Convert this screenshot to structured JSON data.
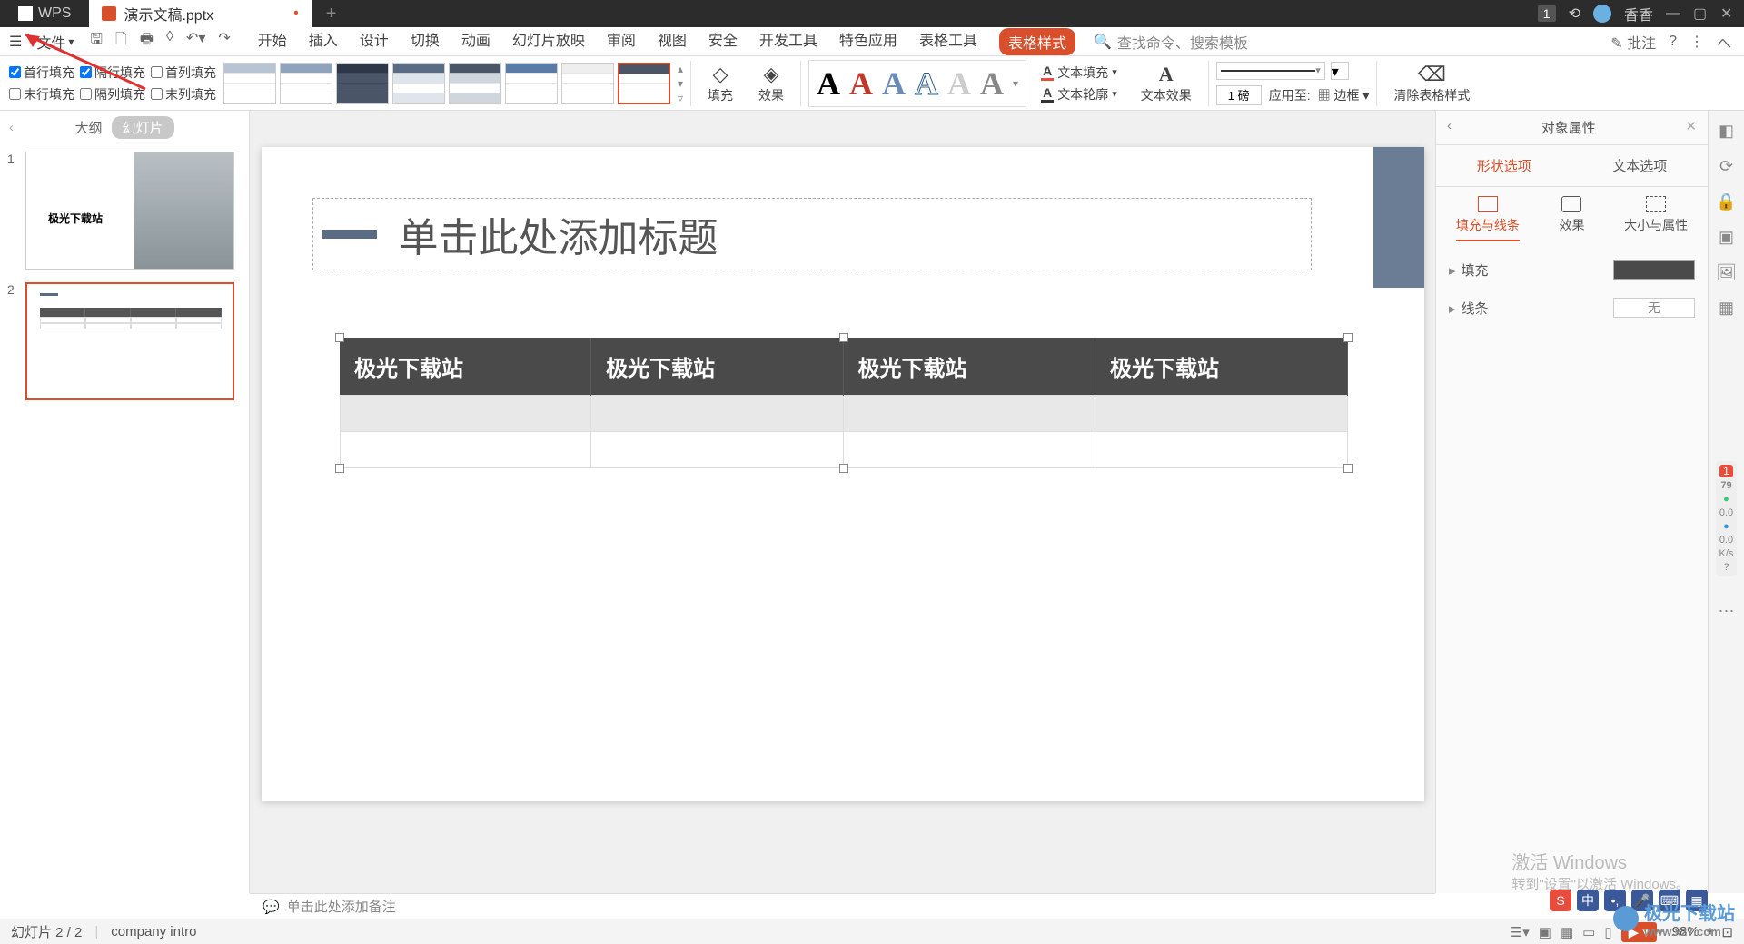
{
  "titlebar": {
    "wps": "WPS",
    "doc_name": "演示文稿.pptx",
    "badge": "1",
    "username": "香香"
  },
  "menubar": {
    "file": "文件",
    "items": [
      "开始",
      "插入",
      "设计",
      "切换",
      "动画",
      "幻灯片放映",
      "审阅",
      "视图",
      "安全",
      "开发工具",
      "特色应用",
      "表格工具",
      "表格样式"
    ],
    "active_index": 12,
    "search_placeholder": "查找命令、搜索模板",
    "annotate": "批注"
  },
  "ribbon": {
    "fills": {
      "r1": [
        "首行填充",
        "隔行填充",
        "首列填充"
      ],
      "r2": [
        "末行填充",
        "隔列填充",
        "末列填充"
      ],
      "checked": [
        true,
        true,
        false,
        false,
        false,
        false
      ]
    },
    "fill_label": "填充",
    "effect_label": "效果",
    "text_fill": "文本填充",
    "text_outline": "文本轮廓",
    "text_effect": "文本效果",
    "pen_weight": "1 磅",
    "apply_to": "应用至:",
    "border": "边框",
    "clear_style": "清除表格样式"
  },
  "panel": {
    "outline": "大纲",
    "slides": "幻灯片",
    "thumb1_text": "极光下载站"
  },
  "slide": {
    "title_placeholder": "单击此处添加标题",
    "table_headers": [
      "极光下载站",
      "极光下载站",
      "极光下载站",
      "极光下载站"
    ]
  },
  "props": {
    "title": "对象属性",
    "tab_shape": "形状选项",
    "tab_text": "文本选项",
    "sub_fill": "填充与线条",
    "sub_effect": "效果",
    "sub_size": "大小与属性",
    "fill": "填充",
    "line": "线条",
    "none": "无"
  },
  "notes": {
    "placeholder": "单击此处添加备注"
  },
  "status": {
    "slide_info": "幻灯片 2 / 2",
    "template": "company intro",
    "zoom": "98%"
  },
  "activate": {
    "title": "激活 Windows",
    "sub": "转到\"设置\"以激活 Windows。"
  },
  "watermark": {
    "site": "极光下载站",
    "url": "www.xz7.com"
  },
  "perf": {
    "count": "1",
    "val": "79",
    "g": "0.0",
    "b": "0.0",
    "unit": "K/s"
  }
}
